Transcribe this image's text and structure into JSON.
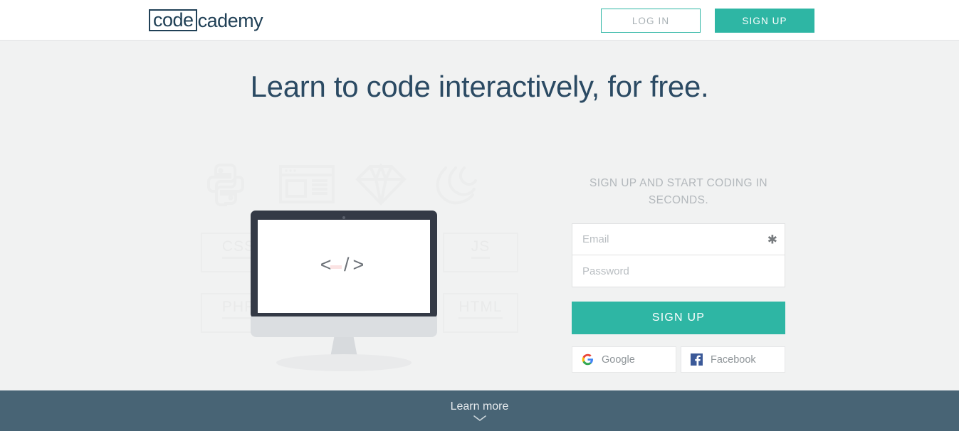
{
  "header": {
    "logo_boxed": "code",
    "logo_rest": "cademy",
    "login_label": "LOG IN",
    "signup_label": "SIGN UP"
  },
  "hero": {
    "title": "Learn to code interactively, for free."
  },
  "illustration": {
    "screen_code": "< />",
    "background_icons": [
      "python-icon",
      "browser-window-icon",
      "ruby-gem-icon",
      "arcs-icon"
    ],
    "tags": [
      "CSS",
      "JS",
      "PHP",
      "HTML"
    ]
  },
  "form": {
    "heading": "SIGN UP AND START CODING IN SECONDS.",
    "email_placeholder": "Email",
    "email_value": "",
    "required_marker": "✱",
    "password_placeholder": "Password",
    "password_value": "",
    "submit_label": "SIGN UP",
    "social": [
      {
        "label": "Google",
        "icon": "google-icon"
      },
      {
        "label": "Facebook",
        "icon": "facebook-icon"
      }
    ]
  },
  "footer": {
    "label": "Learn more",
    "chevron": "chevron-down-icon"
  },
  "colors": {
    "teal": "#2eb6a4",
    "navy": "#204056",
    "heading_blue": "#2b4a63",
    "footer_slate": "#486475",
    "page_bg": "#f1f2f2",
    "monitor_dark": "#343a46",
    "google_blue": "#4285F4",
    "google_red": "#EA4335",
    "google_yellow": "#FBBC05",
    "google_green": "#34A853",
    "facebook_blue": "#3b5998"
  }
}
